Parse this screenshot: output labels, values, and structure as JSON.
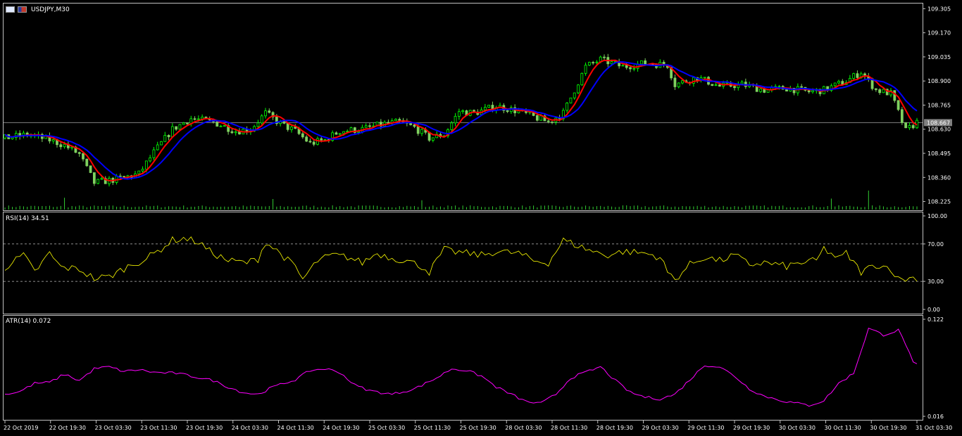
{
  "window": {
    "symbol_label": "USDJPY,M30"
  },
  "price_panel": {
    "current_price": "108.667",
    "ticks": [
      "109.305",
      "109.170",
      "109.035",
      "108.900",
      "108.765",
      "108.630",
      "108.495",
      "108.360",
      "108.225"
    ],
    "ylim": [
      108.18,
      109.33
    ]
  },
  "rsi_panel": {
    "label": "RSI(14) 34.51",
    "ticks": [
      "100.00",
      "70.00",
      "30.00",
      "0.00"
    ],
    "levels": [
      70,
      30
    ]
  },
  "atr_panel": {
    "label": "ATR(14) 0.072",
    "ticks": [
      "0.122",
      "0.016"
    ]
  },
  "time_axis": {
    "labels": [
      "22 Oct 2019",
      "22 Oct 19:30",
      "23 Oct 03:30",
      "23 Oct 11:30",
      "23 Oct 19:30",
      "24 Oct 03:30",
      "24 Oct 11:30",
      "24 Oct 19:30",
      "25 Oct 03:30",
      "25 Oct 11:30",
      "25 Oct 19:30",
      "28 Oct 03:30",
      "28 Oct 11:30",
      "28 Oct 19:30",
      "29 Oct 03:30",
      "29 Oct 11:30",
      "29 Oct 19:30",
      "30 Oct 03:30",
      "30 Oct 11:30",
      "30 Oct 19:30",
      "31 Oct 03:30"
    ]
  },
  "colors": {
    "background": "#000000",
    "bull_candle": "#00ff00",
    "bear_candle": "#7fd15f",
    "ma_fast": "#ff0000",
    "ma_slow": "#0000ff",
    "rsi_line": "#ffff00",
    "atr_line": "#ff00ff",
    "volume": "#32cd32",
    "grid_border": "#c0c0c0"
  },
  "chart_data": [
    {
      "type": "candlestick",
      "title": "USDJPY,M30",
      "ylim": [
        108.18,
        109.33
      ],
      "close_path": [
        [
          0,
          108.58
        ],
        [
          6,
          108.6
        ],
        [
          12,
          108.57
        ],
        [
          16,
          108.54
        ],
        [
          20,
          108.49
        ],
        [
          24,
          108.33
        ],
        [
          30,
          108.35
        ],
        [
          36,
          108.38
        ],
        [
          40,
          108.5
        ],
        [
          45,
          108.63
        ],
        [
          50,
          108.69
        ],
        [
          56,
          108.67
        ],
        [
          62,
          108.62
        ],
        [
          66,
          108.63
        ],
        [
          70,
          108.72
        ],
        [
          74,
          108.66
        ],
        [
          78,
          108.62
        ],
        [
          82,
          108.55
        ],
        [
          86,
          108.57
        ],
        [
          90,
          108.62
        ],
        [
          96,
          108.63
        ],
        [
          102,
          108.66
        ],
        [
          106,
          108.67
        ],
        [
          110,
          108.64
        ],
        [
          114,
          108.58
        ],
        [
          118,
          108.6
        ],
        [
          122,
          108.73
        ],
        [
          126,
          108.72
        ],
        [
          132,
          108.76
        ],
        [
          138,
          108.73
        ],
        [
          142,
          108.7
        ],
        [
          146,
          108.67
        ],
        [
          150,
          108.72
        ],
        [
          156,
          108.98
        ],
        [
          160,
          109.02
        ],
        [
          166,
          108.98
        ],
        [
          172,
          109.0
        ],
        [
          178,
          108.99
        ],
        [
          180,
          108.88
        ],
        [
          186,
          108.92
        ],
        [
          192,
          108.87
        ],
        [
          198,
          108.88
        ],
        [
          204,
          108.85
        ],
        [
          210,
          108.86
        ],
        [
          216,
          108.84
        ],
        [
          220,
          108.85
        ],
        [
          226,
          108.9
        ],
        [
          230,
          108.95
        ],
        [
          234,
          108.85
        ],
        [
          238,
          108.83
        ],
        [
          242,
          108.62
        ],
        [
          245,
          108.67
        ]
      ],
      "n_bars": 246,
      "series": [
        {
          "name": "",
          "smooth": 4,
          "color": "#ff0000"
        },
        {
          "name": "",
          "smooth": 9,
          "color": "#0000ff"
        }
      ]
    },
    {
      "type": "line",
      "title": "RSI(14) 34.51",
      "ylim": [
        0,
        100
      ],
      "path": [
        [
          0,
          45
        ],
        [
          5,
          58
        ],
        [
          8,
          40
        ],
        [
          12,
          60
        ],
        [
          15,
          45
        ],
        [
          20,
          43
        ],
        [
          24,
          33
        ],
        [
          28,
          35
        ],
        [
          34,
          48
        ],
        [
          38,
          54
        ],
        [
          42,
          65
        ],
        [
          45,
          74
        ],
        [
          48,
          76
        ],
        [
          52,
          72
        ],
        [
          55,
          62
        ],
        [
          60,
          52
        ],
        [
          65,
          50
        ],
        [
          68,
          54
        ],
        [
          70,
          72
        ],
        [
          74,
          60
        ],
        [
          78,
          45
        ],
        [
          80,
          32
        ],
        [
          84,
          52
        ],
        [
          88,
          58
        ],
        [
          92,
          56
        ],
        [
          96,
          50
        ],
        [
          100,
          60
        ],
        [
          104,
          55
        ],
        [
          108,
          52
        ],
        [
          112,
          46
        ],
        [
          114,
          40
        ],
        [
          118,
          64
        ],
        [
          120,
          62
        ],
        [
          124,
          60
        ],
        [
          128,
          58
        ],
        [
          132,
          62
        ],
        [
          138,
          60
        ],
        [
          142,
          52
        ],
        [
          146,
          50
        ],
        [
          150,
          74
        ],
        [
          154,
          68
        ],
        [
          158,
          62
        ],
        [
          162,
          58
        ],
        [
          166,
          62
        ],
        [
          172,
          60
        ],
        [
          176,
          56
        ],
        [
          178,
          40
        ],
        [
          180,
          32
        ],
        [
          184,
          48
        ],
        [
          188,
          56
        ],
        [
          192,
          52
        ],
        [
          196,
          58
        ],
        [
          200,
          48
        ],
        [
          204,
          50
        ],
        [
          210,
          46
        ],
        [
          214,
          50
        ],
        [
          218,
          52
        ],
        [
          220,
          65
        ],
        [
          224,
          54
        ],
        [
          226,
          60
        ],
        [
          230,
          40
        ],
        [
          234,
          48
        ],
        [
          238,
          44
        ],
        [
          240,
          32
        ],
        [
          245,
          34
        ]
      ],
      "levels": [
        70,
        30
      ]
    },
    {
      "type": "line",
      "title": "ATR(14) 0.072",
      "ylim": [
        0.016,
        0.122
      ],
      "path": [
        [
          0,
          0.04
        ],
        [
          4,
          0.043
        ],
        [
          8,
          0.052
        ],
        [
          12,
          0.053
        ],
        [
          16,
          0.062
        ],
        [
          20,
          0.055
        ],
        [
          24,
          0.068
        ],
        [
          28,
          0.07
        ],
        [
          32,
          0.065
        ],
        [
          36,
          0.067
        ],
        [
          40,
          0.064
        ],
        [
          46,
          0.063
        ],
        [
          50,
          0.06
        ],
        [
          56,
          0.055
        ],
        [
          60,
          0.048
        ],
        [
          64,
          0.042
        ],
        [
          68,
          0.04
        ],
        [
          72,
          0.048
        ],
        [
          78,
          0.056
        ],
        [
          82,
          0.066
        ],
        [
          86,
          0.068
        ],
        [
          90,
          0.064
        ],
        [
          94,
          0.05
        ],
        [
          98,
          0.044
        ],
        [
          104,
          0.04
        ],
        [
          110,
          0.046
        ],
        [
          116,
          0.058
        ],
        [
          120,
          0.068
        ],
        [
          124,
          0.066
        ],
        [
          128,
          0.06
        ],
        [
          132,
          0.048
        ],
        [
          136,
          0.04
        ],
        [
          140,
          0.032
        ],
        [
          144,
          0.03
        ],
        [
          148,
          0.04
        ],
        [
          152,
          0.058
        ],
        [
          156,
          0.064
        ],
        [
          160,
          0.07
        ],
        [
          164,
          0.055
        ],
        [
          168,
          0.042
        ],
        [
          172,
          0.037
        ],
        [
          176,
          0.035
        ],
        [
          180,
          0.04
        ],
        [
          184,
          0.056
        ],
        [
          188,
          0.072
        ],
        [
          192,
          0.07
        ],
        [
          196,
          0.06
        ],
        [
          200,
          0.046
        ],
        [
          204,
          0.038
        ],
        [
          210,
          0.032
        ],
        [
          216,
          0.028
        ],
        [
          220,
          0.033
        ],
        [
          224,
          0.052
        ],
        [
          228,
          0.063
        ],
        [
          232,
          0.112
        ],
        [
          236,
          0.105
        ],
        [
          240,
          0.11
        ],
        [
          242,
          0.095
        ],
        [
          244,
          0.074
        ],
        [
          245,
          0.072
        ]
      ]
    },
    {
      "type": "bar",
      "title": "",
      "values_description": "",
      "spikes": [
        [
          16,
          1.8
        ],
        [
          72,
          1.5
        ],
        [
          112,
          1.2
        ],
        [
          222,
          1.6
        ],
        [
          232,
          3.5
        ]
      ],
      "base": 1.0
    }
  ]
}
